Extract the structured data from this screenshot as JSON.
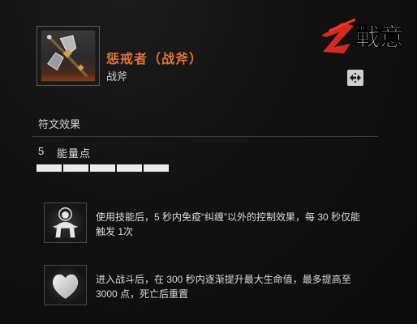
{
  "item": {
    "name": "惩戒者（战斧）",
    "type": "战斧",
    "icon": "battle-axe-icon",
    "name_color": "#e2733a"
  },
  "logo": {
    "text": "戰意",
    "accent": "#d42a20"
  },
  "swap_icon": "swap-arrows-icon",
  "rune_section": {
    "title": "符文效果",
    "energy_value": "5",
    "energy_label": "能量点",
    "energy_segments": 5
  },
  "effects": [
    {
      "icon": "figure-aura-icon",
      "text": "使用技能后，5 秒内免疫“纠缠”以外的控制效果，每 30 秒仅能触发 1次"
    },
    {
      "icon": "heart-icon",
      "text": "进入战斗后，在 300 秒内逐渐提升最大生命值，最多提高至 3000 点，死亡后重置"
    }
  ]
}
